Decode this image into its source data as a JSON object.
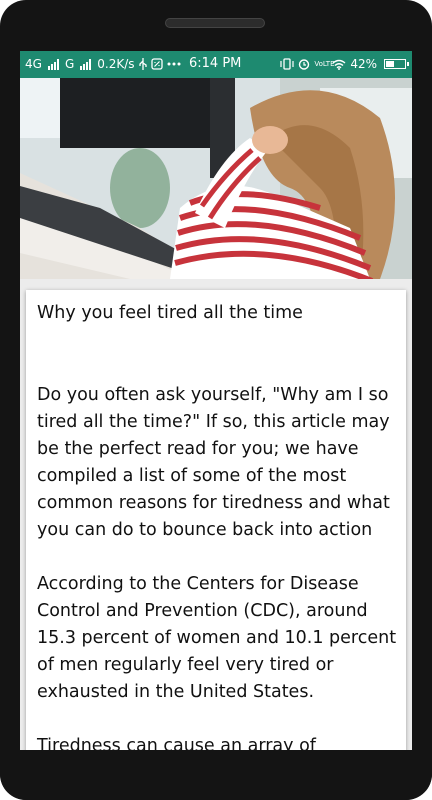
{
  "status_bar": {
    "network_4g": "4G",
    "network_g": "G",
    "speed": "0.2K/s",
    "time": "6:14 PM",
    "volte": "VoLTE",
    "battery_percent": "42%",
    "battery_level": 0.42,
    "background_color": "#1e8a70"
  },
  "hero_image": {
    "subject": "woman-holding-head-at-desk"
  },
  "article": {
    "title": "Why you feel tired all the time",
    "paragraphs": [
      "Do you often ask yourself, \"Why am I so tired all the time?\" If so, this article may be the perfect read for you; we have compiled a list of some of the most common reasons for tiredness and what you can do to bounce back into action",
      "According to the Centers for Disease Control and Prevention (CDC), around 15.3 percent of women and 10.1 percent of men regularly feel very tired or exhausted in the United States.",
      "Tiredness can cause an array of"
    ]
  }
}
